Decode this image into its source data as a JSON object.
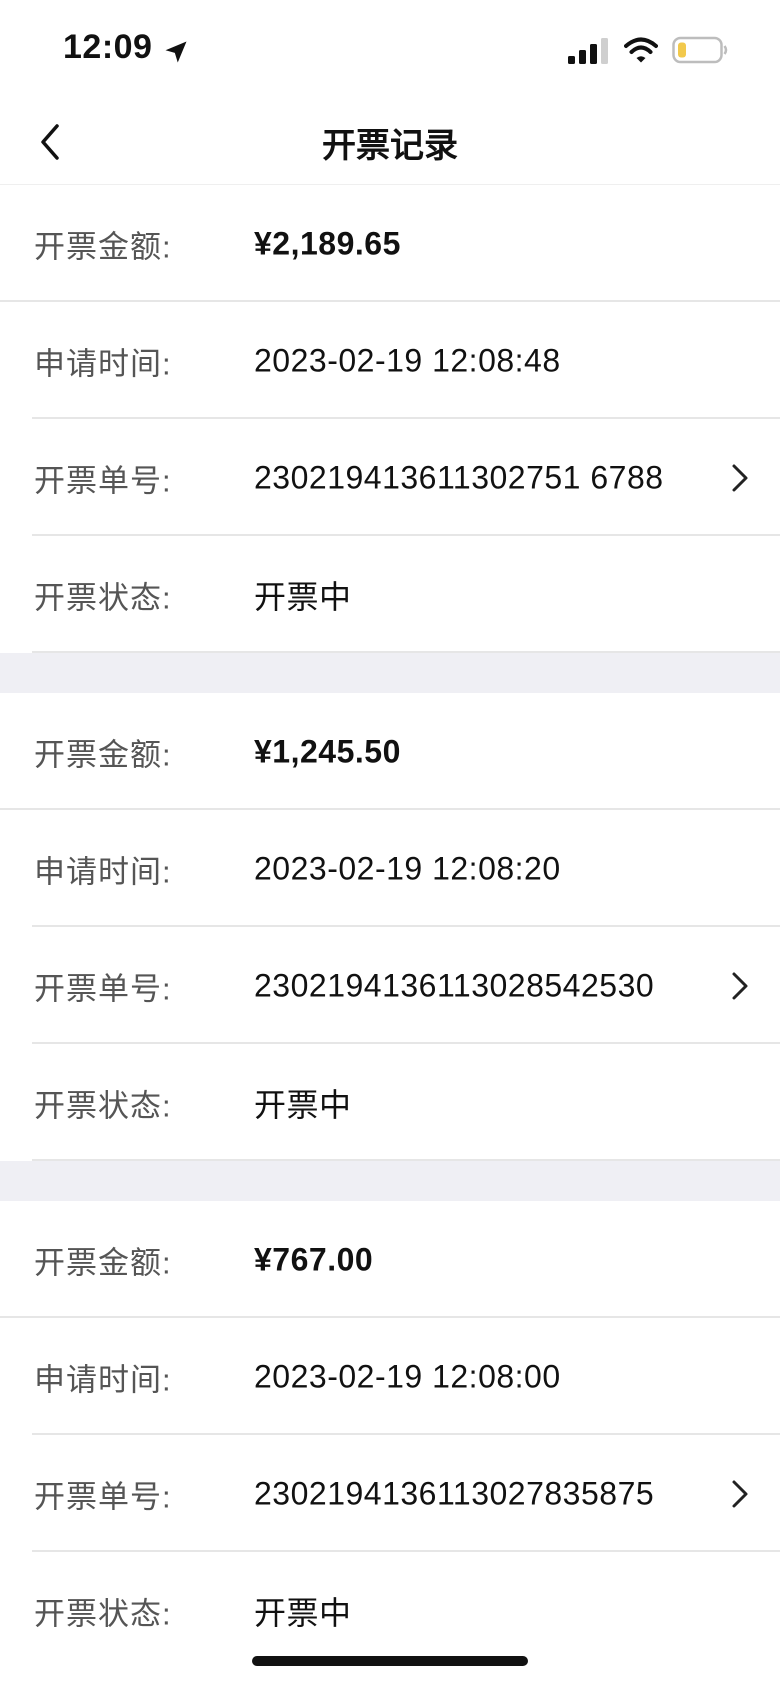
{
  "status_bar": {
    "time": "12:09"
  },
  "nav": {
    "title": "开票记录"
  },
  "labels": {
    "amount": "开票金额:",
    "time": "申请时间:",
    "number": "开票单号:",
    "status": "开票状态:"
  },
  "records": [
    {
      "amount": "¥2,189.65",
      "time": "2023-02-19 12:08:48",
      "number": "230219413611302751 6788",
      "status": "开票中"
    },
    {
      "amount": "¥1,245.50",
      "time": "2023-02-19 12:08:20",
      "number": "2302194136113028542530",
      "status": "开票中"
    },
    {
      "amount": "¥767.00",
      "time": "2023-02-19 12:08:00",
      "number": "2302194136113027835875",
      "status": "开票中"
    }
  ],
  "colors": {
    "page_bg": "#ffffff",
    "section_gap": "#efeff4",
    "divider": "#e6e6e6",
    "label_text": "#555555",
    "value_text": "#111111",
    "battery_level": "#f2c94c"
  },
  "icons": {
    "back": "chevron-left-icon",
    "row_action": "chevron-right-icon",
    "location": "location-arrow-icon",
    "signal": "cellular-signal-icon",
    "wifi": "wifi-icon",
    "battery": "battery-low-icon"
  }
}
